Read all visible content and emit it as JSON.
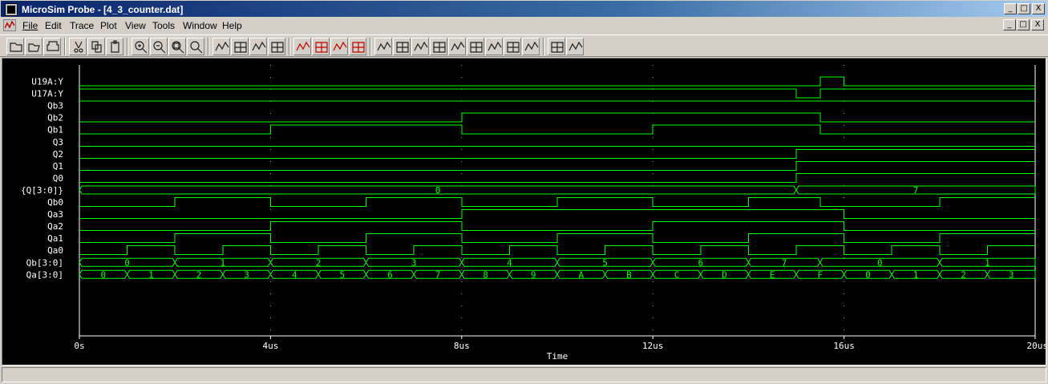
{
  "window": {
    "title": "MicroSim Probe - [4_3_counter.dat]",
    "caption_buttons": [
      "_",
      "□",
      "X"
    ],
    "mdi_buttons": [
      "_",
      "□",
      "X"
    ]
  },
  "menu": [
    {
      "id": "file",
      "label": "File"
    },
    {
      "id": "edit",
      "label": "Edit"
    },
    {
      "id": "trace",
      "label": "Trace"
    },
    {
      "id": "plot",
      "label": "Plot"
    },
    {
      "id": "view",
      "label": "View"
    },
    {
      "id": "tools",
      "label": "Tools"
    },
    {
      "id": "window",
      "label": "Window"
    },
    {
      "id": "help",
      "label": "Help"
    }
  ],
  "toolbar": [
    "open-file-icon",
    "open-folder-icon",
    "print-icon",
    "cut-icon",
    "copy-icon",
    "paste-icon",
    "zoom-in-icon",
    "zoom-out-icon",
    "zoom-area-icon",
    "zoom-fit-icon",
    "toggle-digital-icon",
    "log-x-icon",
    "fourier-icon",
    "table-icon",
    "add-trace-icon",
    "performance-icon",
    "marker-icon",
    "cursor-icon",
    "cursor-peak-icon",
    "cursor-trough-icon",
    "cursor-slope-icon",
    "cursor-min-icon",
    "cursor-max-icon",
    "cursor-point-icon",
    "cursor-search-icon",
    "cursor-next-icon",
    "cursor-prev-icon",
    "mark-label-icon",
    "mark-data-icon"
  ],
  "plot": {
    "time_unit": "us",
    "x_range": [
      0,
      20
    ],
    "x_ticks": [
      {
        "value": 0,
        "label": "0s"
      },
      {
        "value": 4,
        "label": "4us"
      },
      {
        "value": 8,
        "label": "8us"
      },
      {
        "value": 12,
        "label": "12us"
      },
      {
        "value": 16,
        "label": "16us"
      },
      {
        "value": 20,
        "label": "20us"
      }
    ],
    "x_axis_label": "Time",
    "colors": {
      "background": "#000000",
      "trace": "#00ff00",
      "text": "#ffffff",
      "grid": "#a0a0a0"
    },
    "signals": [
      {
        "name": "U19A:Y",
        "type": "bit",
        "init": 0,
        "toggles": [
          15.5,
          16.0
        ]
      },
      {
        "name": "U17A:Y",
        "type": "bit",
        "init": 1,
        "toggles": [
          15.0,
          15.5
        ]
      },
      {
        "name": "Qb3",
        "type": "bit",
        "init": 1,
        "toggles": []
      },
      {
        "name": "Qb2",
        "type": "bit",
        "init": 0,
        "toggles": [
          8.0,
          15.5
        ]
      },
      {
        "name": "Qb1",
        "type": "bit",
        "init": 0,
        "toggles": [
          4.0,
          8.0,
          12.0,
          15.5
        ]
      },
      {
        "name": "Q3",
        "type": "bit",
        "init": 0,
        "toggles": []
      },
      {
        "name": "Q2",
        "type": "bit",
        "init": 0,
        "toggles": [
          15.0
        ]
      },
      {
        "name": "Q1",
        "type": "bit",
        "init": 0,
        "toggles": [
          15.0
        ]
      },
      {
        "name": "Q0",
        "type": "bit",
        "init": 0,
        "toggles": [
          15.0
        ]
      },
      {
        "name": "{Q[3:0]}",
        "type": "bus",
        "segments": [
          [
            0,
            15.0,
            "0"
          ],
          [
            15.0,
            20,
            "7"
          ]
        ]
      },
      {
        "name": "Qb0",
        "type": "bit",
        "init": 0,
        "toggles": [
          2,
          4,
          6,
          8,
          10,
          12,
          14,
          15.5,
          18
        ]
      },
      {
        "name": "Qa3",
        "type": "bit",
        "init": 0,
        "toggles": [
          8.0,
          16.0
        ]
      },
      {
        "name": "Qa2",
        "type": "bit",
        "init": 0,
        "toggles": [
          4.0,
          8.0,
          12.0,
          16.0
        ]
      },
      {
        "name": "Qa1",
        "type": "bit",
        "init": 0,
        "toggles": [
          2,
          4,
          6,
          8,
          10,
          12,
          14,
          16,
          18
        ]
      },
      {
        "name": "Qa0",
        "type": "bit",
        "init": 0,
        "toggles": [
          1,
          2,
          3,
          4,
          5,
          6,
          7,
          8,
          9,
          10,
          11,
          12,
          13,
          14,
          15,
          16,
          17,
          18,
          19
        ]
      },
      {
        "name": "Qb[3:0]",
        "type": "bus",
        "segments": [
          [
            0,
            2,
            "0"
          ],
          [
            2,
            4,
            "1"
          ],
          [
            4,
            6,
            "2"
          ],
          [
            6,
            8,
            "3"
          ],
          [
            8,
            10,
            "4"
          ],
          [
            10,
            12,
            "5"
          ],
          [
            12,
            14,
            "6"
          ],
          [
            14,
            15.5,
            "7"
          ],
          [
            15.5,
            18,
            "0"
          ],
          [
            18,
            20,
            "1"
          ]
        ]
      },
      {
        "name": "Qa[3:0]",
        "type": "bus",
        "segments": [
          [
            0,
            1,
            "0"
          ],
          [
            1,
            2,
            "1"
          ],
          [
            2,
            3,
            "2"
          ],
          [
            3,
            4,
            "3"
          ],
          [
            4,
            5,
            "4"
          ],
          [
            5,
            6,
            "5"
          ],
          [
            6,
            7,
            "6"
          ],
          [
            7,
            8,
            "7"
          ],
          [
            8,
            9,
            "8"
          ],
          [
            9,
            10,
            "9"
          ],
          [
            10,
            11,
            "A"
          ],
          [
            11,
            12,
            "B"
          ],
          [
            12,
            13,
            "C"
          ],
          [
            13,
            14,
            "D"
          ],
          [
            14,
            15,
            "E"
          ],
          [
            15,
            16,
            "F"
          ],
          [
            16,
            17,
            "0"
          ],
          [
            17,
            18,
            "1"
          ],
          [
            18,
            19,
            "2"
          ],
          [
            19,
            20,
            "3"
          ]
        ]
      }
    ]
  },
  "statusbar": {
    "text": ""
  }
}
